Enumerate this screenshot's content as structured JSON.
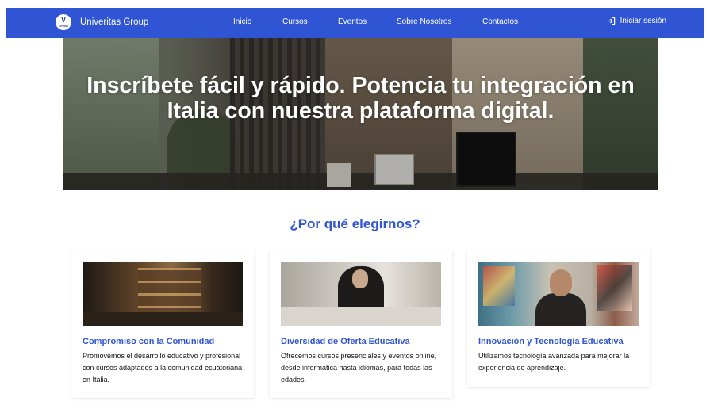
{
  "navbar": {
    "logo_letter": "V",
    "logo_small": "Veritas",
    "brand": "Univeritas Group",
    "links": [
      "Inicio",
      "Cursos",
      "Eventos",
      "Sobre Nosotros",
      "Contactos"
    ],
    "login_label": "Iniciar sesión",
    "bg_color": "#2f55d4"
  },
  "hero": {
    "headline_line1": "Inscríbete fácil y rápido. Potencia tu integración en",
    "headline_line2": "Italia con nuestra plataforma digital."
  },
  "features": {
    "title": "¿Por qué elegirnos?",
    "cards": [
      {
        "image_name": "shelf-interior-photo",
        "title": "Compromiso con la Comunidad",
        "text": "Promovemos el desarrollo educativo y profesional con cursos adaptados a la comunidad ecuatoriana en Italia."
      },
      {
        "image_name": "woman-laptop-photo",
        "title": "Diversidad de Oferta Educativa",
        "text": "Ofrecemos cursos presenciales y eventos online, desde informática hasta idiomas, para todas las edades."
      },
      {
        "image_name": "man-portrait-photo",
        "title": "Innovación y Tecnología Educativa",
        "text": "Utilizamos tecnología avanzada para mejorar la experiencia de aprendizaje."
      }
    ]
  }
}
